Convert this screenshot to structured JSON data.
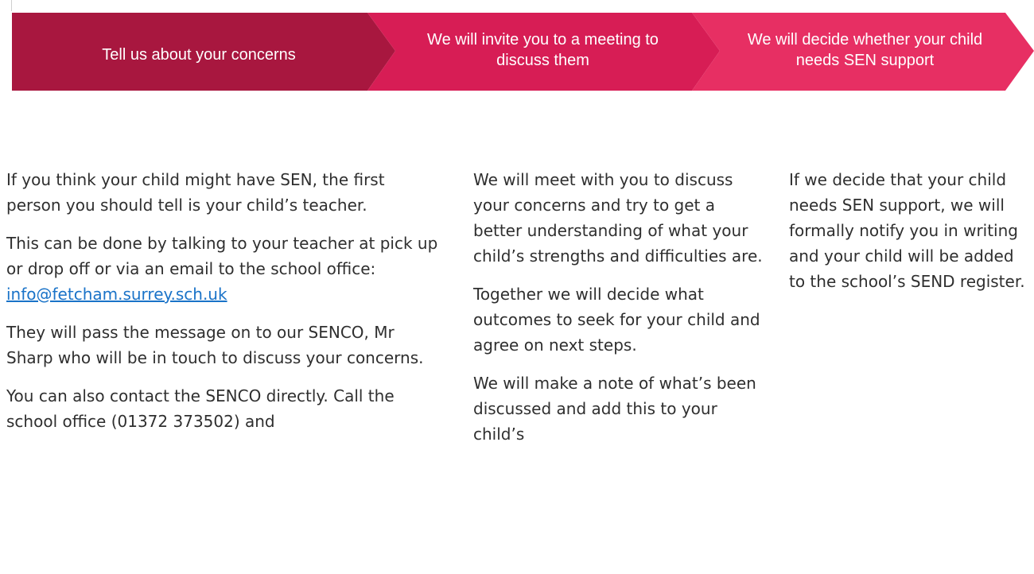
{
  "colors": {
    "step1": "#a8173f",
    "step2": "#d71d55",
    "step3": "#e72f63",
    "link": "#1a73c8",
    "text": "#2f2f2f"
  },
  "process_steps": [
    {
      "label": "Tell us about your concerns"
    },
    {
      "label": "We will invite you to a meeting to discuss them"
    },
    {
      "label": "We will decide whether your child needs SEN support"
    }
  ],
  "column1": {
    "p1": "If you think your child might have SEN, the first person you should tell is your child’s teacher.",
    "p2": "This can be done by talking to your teacher at pick up or drop off or via an email to the school office:",
    "email": "info@fetcham.surrey.sch.uk",
    "p3": "They will pass the message on to our SENCO, Mr Sharp who will be in touch to discuss your concerns.",
    "p4": "You can also contact the SENCO directly. Call the school office (01372 373502) and"
  },
  "column2": {
    "p1": "We will meet with you to discuss your concerns and try to get a better understanding of what your child’s strengths and difficulties are.",
    "p2": "Together we will decide what outcomes to seek for your child and agree on next steps.",
    "p3": "We will make a note of what’s been discussed and add this to your child’s"
  },
  "column3": {
    "p1": "If we decide that your child needs SEN support, we will formally notify you in writing and your child will be added to the school’s SEND register."
  }
}
